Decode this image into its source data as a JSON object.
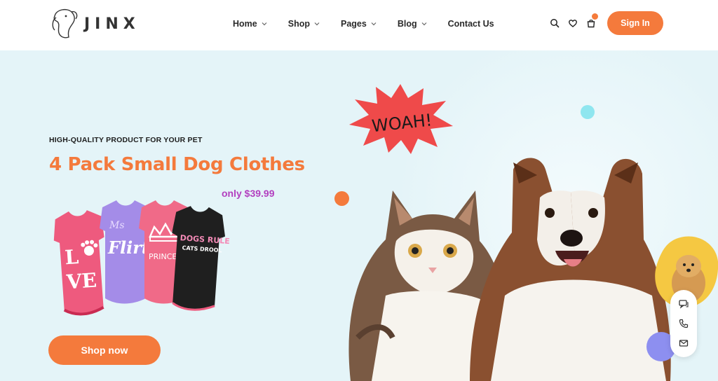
{
  "brand": {
    "name": "JINX"
  },
  "nav": {
    "items": [
      {
        "label": "Home",
        "has_dropdown": true
      },
      {
        "label": "Shop",
        "has_dropdown": true
      },
      {
        "label": "Pages",
        "has_dropdown": true
      },
      {
        "label": "Blog",
        "has_dropdown": true
      },
      {
        "label": "Contact Us",
        "has_dropdown": false
      }
    ]
  },
  "header_icons": [
    "search-icon",
    "heart-icon",
    "cart-icon"
  ],
  "header": {
    "signin_label": "Sign In"
  },
  "hero": {
    "subtitle": "HIGH-QUALITY PRODUCT FOR YOUR PET",
    "title": "4 Pack Small Dog Clothes",
    "price": "only $39.99",
    "cta_label": "Shop now",
    "sticker_text": "WOAH!",
    "shirts": [
      {
        "text": "LOVE",
        "color": "#ee5a7e"
      },
      {
        "text": "Flirt",
        "color": "#a48ce8"
      },
      {
        "text": "PRINCE",
        "color": "#f06a88"
      },
      {
        "text": "DOGS RULE CATS DROOL",
        "color": "#1f1f1f"
      }
    ]
  },
  "floating_bar_icons": [
    "chat-icon",
    "phone-icon",
    "mail-icon"
  ],
  "colors": {
    "accent": "#f47a3c",
    "price": "#b23fbf",
    "hero_bg": "#e4f4f8",
    "sticker": "#ef4a4a"
  }
}
